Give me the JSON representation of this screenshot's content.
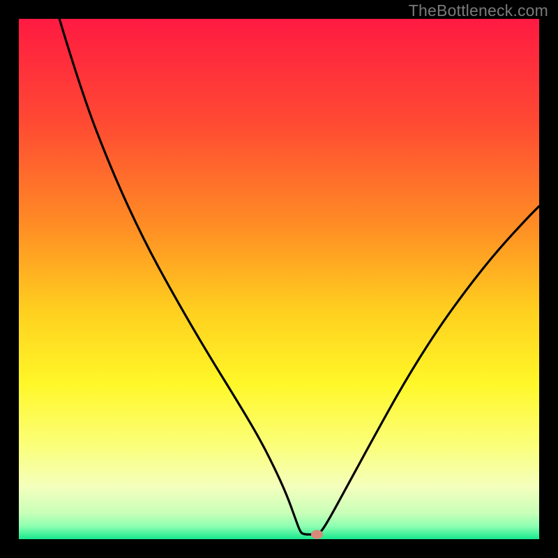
{
  "watermark": "TheBottleneck.com",
  "chart_data": {
    "type": "line",
    "title": "",
    "xlabel": "",
    "ylabel": "",
    "xlim": [
      0,
      100
    ],
    "ylim": [
      0,
      100
    ],
    "grid": false,
    "gradient_stops": [
      {
        "offset": 0.0,
        "color": "#ff1a42"
      },
      {
        "offset": 0.2,
        "color": "#ff4a33"
      },
      {
        "offset": 0.4,
        "color": "#ff8e24"
      },
      {
        "offset": 0.56,
        "color": "#ffcf1f"
      },
      {
        "offset": 0.7,
        "color": "#fff728"
      },
      {
        "offset": 0.82,
        "color": "#fbff7a"
      },
      {
        "offset": 0.9,
        "color": "#f4ffbd"
      },
      {
        "offset": 0.95,
        "color": "#c8ffb8"
      },
      {
        "offset": 0.975,
        "color": "#8dffb1"
      },
      {
        "offset": 1.0,
        "color": "#17e88e"
      }
    ],
    "series": [
      {
        "name": "curve",
        "points": [
          {
            "x": 7.8,
            "y": 100.0
          },
          {
            "x": 12.0,
            "y": 86.0
          },
          {
            "x": 18.0,
            "y": 70.5
          },
          {
            "x": 24.0,
            "y": 57.5
          },
          {
            "x": 30.0,
            "y": 46.5
          },
          {
            "x": 36.0,
            "y": 36.2
          },
          {
            "x": 42.0,
            "y": 26.5
          },
          {
            "x": 46.0,
            "y": 19.8
          },
          {
            "x": 49.0,
            "y": 14.0
          },
          {
            "x": 51.5,
            "y": 8.5
          },
          {
            "x": 53.2,
            "y": 3.8
          },
          {
            "x": 54.0,
            "y": 1.6
          },
          {
            "x": 54.6,
            "y": 0.9
          },
          {
            "x": 57.0,
            "y": 0.9
          },
          {
            "x": 57.8,
            "y": 1.2
          },
          {
            "x": 58.5,
            "y": 2.0
          },
          {
            "x": 60.0,
            "y": 4.5
          },
          {
            "x": 63.0,
            "y": 10.0
          },
          {
            "x": 68.0,
            "y": 19.2
          },
          {
            "x": 74.0,
            "y": 30.0
          },
          {
            "x": 80.0,
            "y": 39.6
          },
          {
            "x": 86.0,
            "y": 48.0
          },
          {
            "x": 92.0,
            "y": 55.5
          },
          {
            "x": 98.0,
            "y": 62.0
          },
          {
            "x": 100.0,
            "y": 64.0
          }
        ]
      }
    ],
    "marker": {
      "x": 57.3,
      "y": 0.9,
      "color": "#d78a7a"
    }
  }
}
